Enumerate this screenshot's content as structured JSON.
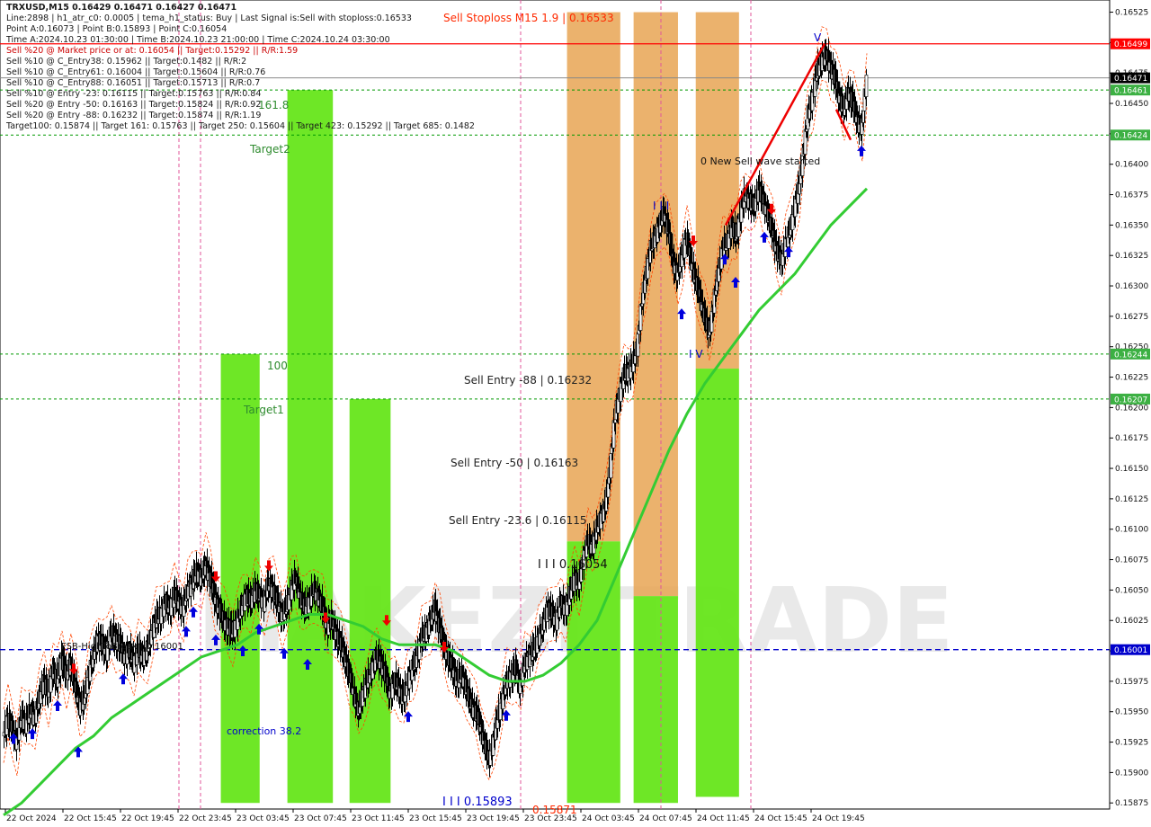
{
  "header": {
    "symbol": "TRXUSD,M15  0.16429 0.16471 0.16427 0.16471",
    "lines": [
      "Line:2898 | h1_atr_c0: 0.0005 | tema_h1_status: Buy | Last Signal is:Sell with stoploss:0.16533",
      "Point A:0.16073 | Point B:0.15893 | Point C:0.16054",
      "Time A:2024.10.23 01:30:00 | Time B:2024.10.23 21:00:00 | Time C:2024.10.24 03:30:00",
      "Sell %20 @ Market price or at: 0.16054 || Target:0.15292 || R/R:1.59",
      "Sell %10 @ C_Entry38: 0.15962 || Target:0.1482 || R/R:2",
      "Sell %10 @ C_Entry61: 0.16004 || Target:0.15604 || R/R:0.76",
      "Sell %10 @ C_Entry88: 0.16051 || Target:0.15713 || R/R:0.7",
      "Sell %10 @ Entry -23: 0.16115 || Target:0.15763 || R/R:0.84",
      "Sell %20 @ Entry -50: 0.16163 || Target:0.15824 || R/R:0.92",
      "Sell %20 @ Entry -88: 0.16232 || Target:0.15874 || R/R:1.19",
      "Target100: 0.15874 || Target 161: 0.15763 || Target 250: 0.15604 || Target 423: 0.15292 || Target 685: 0.1482"
    ],
    "red_line_indices": [
      4
    ]
  },
  "annotations": {
    "sell_stoploss": "Sell Stoploss M15 1.9 | 0.16533",
    "sell_entry_88": "Sell Entry -88 | 0.16232",
    "sell_entry_50": "Sell Entry -50 | 0.16163",
    "sell_entry_23": "Sell Entry -23.6 | 0.16115",
    "point_c": "I I I 0.16054",
    "point_b": "I I I 0.15893",
    "fsb": "FSB-HighToBreak | 0.16001",
    "target2": "Target2",
    "target1": "Target1",
    "fib_161": "161.8",
    "fib_100": "100",
    "correction": "correction 38.2",
    "new_wave": "0 New Sell wave started",
    "wave_iii": "I I I",
    "wave_iv": "I V",
    "wave_v": "V",
    "bottom_partial": "0.15871"
  },
  "watermark": "MAKEZI TRADE",
  "colors": {
    "green_bar": "#66e61a",
    "orange_bar": "#e8a553",
    "ma_green": "#33cc33",
    "envelope": "#ff4400",
    "red_hline": "#ff0000",
    "green_hline": "#009900",
    "blue_hline": "#0000cc",
    "fib_text": "#2e8b2e",
    "price_tag_green": "#3cb043",
    "price_tag_red": "#ff0000",
    "price_tag_blue": "#0000cc"
  },
  "chart_data": {
    "type": "candlestick",
    "symbol": "TRXUSD",
    "timeframe": "M15",
    "ylim": [
      0.1587,
      0.16535
    ],
    "y_ticks": [
      "0.16525",
      "0.16500",
      "0.16475",
      "0.16450",
      "0.16425",
      "0.16400",
      "0.16375",
      "0.16350",
      "0.16325",
      "0.16300",
      "0.16275",
      "0.16250",
      "0.16225",
      "0.16200",
      "0.16175",
      "0.16150",
      "0.16125",
      "0.16100",
      "0.16075",
      "0.16050",
      "0.16025",
      "0.16000",
      "0.15975",
      "0.15950",
      "0.15925",
      "0.15900",
      "0.15875"
    ],
    "x_ticks": [
      "22 Oct 2024",
      "22 Oct 15:45",
      "22 Oct 19:45",
      "22 Oct 23:45",
      "23 Oct 03:45",
      "23 Oct 07:45",
      "23 Oct 11:45",
      "23 Oct 15:45",
      "23 Oct 19:45",
      "23 Oct 23:45",
      "24 Oct 03:45",
      "24 Oct 07:45",
      "24 Oct 11:45",
      "24 Oct 15:45",
      "24 Oct 19:45"
    ],
    "price_tags": [
      {
        "value": 0.16499,
        "label": "0.16499",
        "style": "red"
      },
      {
        "value": 0.16471,
        "label": "0.16471",
        "style": "black"
      },
      {
        "value": 0.16461,
        "label": "0.16461",
        "style": "green"
      },
      {
        "value": 0.16424,
        "label": "0.16424",
        "style": "green"
      },
      {
        "value": 0.16244,
        "label": "0.16244",
        "style": "green"
      },
      {
        "value": 0.16207,
        "label": "0.16207",
        "style": "green"
      },
      {
        "value": 0.16001,
        "label": "0.16001",
        "style": "blue"
      }
    ],
    "hlines": [
      {
        "value": 0.16499,
        "style": "red-solid"
      },
      {
        "value": 0.16471,
        "style": "gray-solid"
      },
      {
        "value": 0.16461,
        "style": "green-dashed"
      },
      {
        "value": 0.16424,
        "style": "green-dashed"
      },
      {
        "value": 0.16244,
        "style": "green-dashed"
      },
      {
        "value": 0.16207,
        "style": "green-dashed"
      },
      {
        "value": 0.16001,
        "style": "blue-dashed"
      }
    ],
    "close_path": [
      [
        0,
        0.1593
      ],
      [
        5,
        0.15945
      ],
      [
        10,
        0.15935
      ],
      [
        15,
        0.15925
      ],
      [
        20,
        0.15945
      ],
      [
        25,
        0.1594
      ],
      [
        30,
        0.1595
      ],
      [
        35,
        0.15945
      ],
      [
        40,
        0.1596
      ],
      [
        45,
        0.15975
      ],
      [
        50,
        0.15965
      ],
      [
        55,
        0.15985
      ],
      [
        60,
        0.15975
      ],
      [
        65,
        0.15995
      ],
      [
        70,
        0.1598
      ],
      [
        75,
        0.1599
      ],
      [
        80,
        0.1597
      ],
      [
        85,
        0.15955
      ],
      [
        90,
        0.1596
      ],
      [
        95,
        0.1598
      ],
      [
        100,
        0.15995
      ],
      [
        105,
        0.1601
      ],
      [
        110,
        0.16005
      ],
      [
        115,
        0.16
      ],
      [
        120,
        0.16015
      ],
      [
        125,
        0.1601
      ],
      [
        130,
        0.16005
      ],
      [
        135,
        0.15995
      ],
      [
        140,
        0.16
      ],
      [
        145,
        0.1599
      ],
      [
        150,
        0.16
      ],
      [
        155,
        0.15995
      ],
      [
        160,
        0.16
      ],
      [
        165,
        0.16015
      ],
      [
        170,
        0.16025
      ],
      [
        175,
        0.1603
      ],
      [
        180,
        0.1604
      ],
      [
        185,
        0.16035
      ],
      [
        190,
        0.16045
      ],
      [
        195,
        0.1604
      ],
      [
        200,
        0.16035
      ],
      [
        205,
        0.1605
      ],
      [
        210,
        0.16055
      ],
      [
        215,
        0.16065
      ],
      [
        220,
        0.1606
      ],
      [
        225,
        0.1607
      ],
      [
        230,
        0.1606
      ],
      [
        235,
        0.16045
      ],
      [
        240,
        0.16035
      ],
      [
        245,
        0.16025
      ],
      [
        250,
        0.1602
      ],
      [
        255,
        0.16015
      ],
      [
        260,
        0.16025
      ],
      [
        265,
        0.16035
      ],
      [
        270,
        0.16045
      ],
      [
        275,
        0.1604
      ],
      [
        280,
        0.1605
      ],
      [
        285,
        0.16045
      ],
      [
        290,
        0.1604
      ],
      [
        295,
        0.16055
      ],
      [
        300,
        0.1605
      ],
      [
        305,
        0.1604
      ],
      [
        310,
        0.1603
      ],
      [
        315,
        0.16035
      ],
      [
        320,
        0.1605
      ],
      [
        325,
        0.1606
      ],
      [
        330,
        0.16045
      ],
      [
        335,
        0.16035
      ],
      [
        340,
        0.1604
      ],
      [
        345,
        0.1605
      ],
      [
        350,
        0.16045
      ],
      [
        355,
        0.16035
      ],
      [
        360,
        0.1602
      ],
      [
        365,
        0.16025
      ],
      [
        370,
        0.16015
      ],
      [
        375,
        0.16005
      ],
      [
        380,
        0.15995
      ],
      [
        385,
        0.1598
      ],
      [
        390,
        0.15965
      ],
      [
        395,
        0.1595
      ],
      [
        400,
        0.15965
      ],
      [
        405,
        0.15975
      ],
      [
        410,
        0.15985
      ],
      [
        415,
        0.15995
      ],
      [
        420,
        0.1599
      ],
      [
        425,
        0.1598
      ],
      [
        430,
        0.15965
      ],
      [
        435,
        0.15975
      ],
      [
        440,
        0.1597
      ],
      [
        445,
        0.1596
      ],
      [
        450,
        0.15975
      ],
      [
        455,
        0.15985
      ],
      [
        460,
        0.15995
      ],
      [
        465,
        0.1601
      ],
      [
        470,
        0.16015
      ],
      [
        475,
        0.16025
      ],
      [
        480,
        0.16035
      ],
      [
        485,
        0.1602
      ],
      [
        490,
        0.16005
      ],
      [
        495,
        0.15995
      ],
      [
        500,
        0.15985
      ],
      [
        505,
        0.15975
      ],
      [
        510,
        0.1598
      ],
      [
        515,
        0.1597
      ],
      [
        520,
        0.15955
      ],
      [
        525,
        0.1595
      ],
      [
        530,
        0.1594
      ],
      [
        535,
        0.15925
      ],
      [
        540,
        0.1591
      ],
      [
        545,
        0.15925
      ],
      [
        550,
        0.15945
      ],
      [
        555,
        0.1596
      ],
      [
        560,
        0.15975
      ],
      [
        565,
        0.1598
      ],
      [
        570,
        0.15985
      ],
      [
        575,
        0.1597
      ],
      [
        580,
        0.1599
      ],
      [
        585,
        0.15995
      ],
      [
        590,
        0.16
      ],
      [
        595,
        0.1601
      ],
      [
        600,
        0.1602
      ],
      [
        605,
        0.16035
      ],
      [
        610,
        0.1603
      ],
      [
        615,
        0.16025
      ],
      [
        620,
        0.1604
      ],
      [
        625,
        0.16035
      ],
      [
        630,
        0.16045
      ],
      [
        635,
        0.1606
      ],
      [
        640,
        0.16055
      ],
      [
        645,
        0.16075
      ],
      [
        650,
        0.1609
      ],
      [
        655,
        0.16085
      ],
      [
        660,
        0.161
      ],
      [
        665,
        0.1611
      ],
      [
        670,
        0.1612
      ],
      [
        675,
        0.1615
      ],
      [
        680,
        0.1619
      ],
      [
        685,
        0.1621
      ],
      [
        690,
        0.16225
      ],
      [
        695,
        0.1623
      ],
      [
        700,
        0.16235
      ],
      [
        705,
        0.1625
      ],
      [
        710,
        0.16285
      ],
      [
        715,
        0.1631
      ],
      [
        720,
        0.1633
      ],
      [
        725,
        0.1634
      ],
      [
        730,
        0.1635
      ],
      [
        735,
        0.1636
      ],
      [
        740,
        0.16345
      ],
      [
        745,
        0.1632
      ],
      [
        750,
        0.1631
      ],
      [
        755,
        0.16325
      ],
      [
        760,
        0.1634
      ],
      [
        765,
        0.1632
      ],
      [
        770,
        0.16305
      ],
      [
        775,
        0.1629
      ],
      [
        780,
        0.16275
      ],
      [
        785,
        0.1626
      ],
      [
        790,
        0.16285
      ],
      [
        795,
        0.1631
      ],
      [
        800,
        0.1633
      ],
      [
        805,
        0.16335
      ],
      [
        810,
        0.1635
      ],
      [
        815,
        0.1634
      ],
      [
        820,
        0.1636
      ],
      [
        825,
        0.16375
      ],
      [
        830,
        0.1637
      ],
      [
        835,
        0.16365
      ],
      [
        840,
        0.1638
      ],
      [
        845,
        0.1637
      ],
      [
        850,
        0.1636
      ],
      [
        855,
        0.16345
      ],
      [
        860,
        0.1633
      ],
      [
        865,
        0.1632
      ],
      [
        870,
        0.16335
      ],
      [
        875,
        0.16345
      ],
      [
        880,
        0.16365
      ],
      [
        885,
        0.1638
      ],
      [
        890,
        0.1641
      ],
      [
        895,
        0.1644
      ],
      [
        900,
        0.16455
      ],
      [
        905,
        0.16475
      ],
      [
        910,
        0.16485
      ],
      [
        915,
        0.1649
      ],
      [
        920,
        0.1648
      ],
      [
        925,
        0.1647
      ],
      [
        930,
        0.16455
      ],
      [
        935,
        0.16445
      ],
      [
        940,
        0.1646
      ],
      [
        945,
        0.1645
      ],
      [
        950,
        0.16435
      ],
      [
        955,
        0.1643
      ],
      [
        960,
        0.16471
      ]
    ],
    "ma_path": [
      [
        0,
        0.15865
      ],
      [
        20,
        0.15875
      ],
      [
        40,
        0.1589
      ],
      [
        60,
        0.15905
      ],
      [
        80,
        0.1592
      ],
      [
        100,
        0.1593
      ],
      [
        120,
        0.15945
      ],
      [
        140,
        0.15955
      ],
      [
        160,
        0.15965
      ],
      [
        180,
        0.15975
      ],
      [
        200,
        0.15985
      ],
      [
        220,
        0.15995
      ],
      [
        240,
        0.16
      ],
      [
        260,
        0.16005
      ],
      [
        280,
        0.16015
      ],
      [
        300,
        0.1602
      ],
      [
        320,
        0.16025
      ],
      [
        340,
        0.1603
      ],
      [
        360,
        0.1603
      ],
      [
        380,
        0.16025
      ],
      [
        400,
        0.1602
      ],
      [
        420,
        0.1601
      ],
      [
        440,
        0.16005
      ],
      [
        460,
        0.16005
      ],
      [
        480,
        0.16005
      ],
      [
        500,
        0.16
      ],
      [
        520,
        0.1599
      ],
      [
        540,
        0.1598
      ],
      [
        560,
        0.15975
      ],
      [
        580,
        0.15975
      ],
      [
        600,
        0.1598
      ],
      [
        620,
        0.1599
      ],
      [
        640,
        0.16005
      ],
      [
        660,
        0.16025
      ],
      [
        680,
        0.1606
      ],
      [
        700,
        0.16095
      ],
      [
        720,
        0.1613
      ],
      [
        740,
        0.16165
      ],
      [
        760,
        0.16195
      ],
      [
        780,
        0.1622
      ],
      [
        800,
        0.1624
      ],
      [
        820,
        0.1626
      ],
      [
        840,
        0.1628
      ],
      [
        860,
        0.16295
      ],
      [
        880,
        0.1631
      ],
      [
        900,
        0.1633
      ],
      [
        920,
        0.1635
      ],
      [
        940,
        0.16365
      ],
      [
        960,
        0.1638
      ]
    ],
    "bars": [
      {
        "x0": 0.199,
        "x1": 0.234,
        "from": 0.15875,
        "to": 0.16244,
        "color": "green"
      },
      {
        "x0": 0.259,
        "x1": 0.3,
        "from": 0.15875,
        "to": 0.16461,
        "color": "green"
      },
      {
        "x0": 0.315,
        "x1": 0.352,
        "from": 0.15875,
        "to": 0.16207,
        "color": "green"
      },
      {
        "x0": 0.511,
        "x1": 0.559,
        "from": 0.1609,
        "to": 0.16525,
        "color": "orange"
      },
      {
        "x0": 0.511,
        "x1": 0.559,
        "from": 0.15875,
        "to": 0.1609,
        "color": "green"
      },
      {
        "x0": 0.571,
        "x1": 0.611,
        "from": 0.16045,
        "to": 0.16525,
        "color": "orange"
      },
      {
        "x0": 0.571,
        "x1": 0.611,
        "from": 0.15875,
        "to": 0.16045,
        "color": "green"
      },
      {
        "x0": 0.627,
        "x1": 0.666,
        "from": 0.16232,
        "to": 0.16525,
        "color": "orange"
      },
      {
        "x0": 0.627,
        "x1": 0.666,
        "from": 0.1588,
        "to": 0.16232,
        "color": "green"
      }
    ]
  }
}
